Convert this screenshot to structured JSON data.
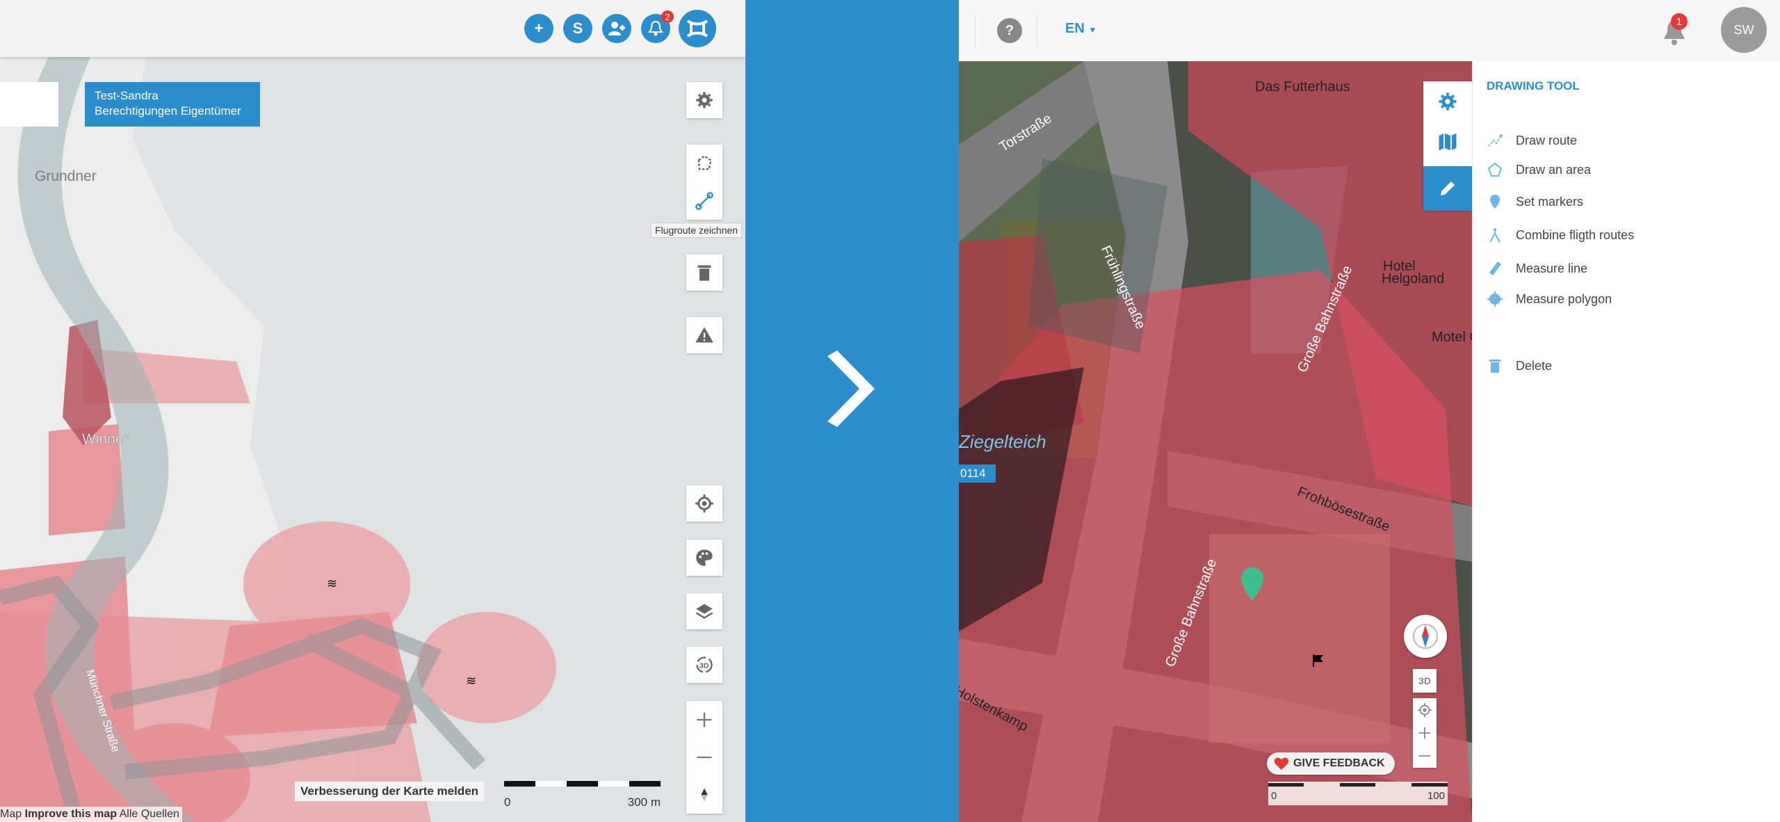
{
  "left": {
    "toolbar": {
      "add_button": "+",
      "s_button": "S",
      "add_user_button": "add-user-icon",
      "notification_count": "2",
      "logo": "drone-logo-icon"
    },
    "tooltip": {
      "line1": "Test-Sandra",
      "line2": "Berechtigungen Eigentümer"
    },
    "map_labels": {
      "grundner": "Grundner",
      "winner": "Winner",
      "street": "Münchner Straße"
    },
    "route_tooltip": "Flugroute zeichnen",
    "report_button": "Verbesserung der Karte melden",
    "scale": {
      "start": "0",
      "end": "300 m"
    },
    "attribution": {
      "map": "Map",
      "improve": "Improve this map",
      "sources": "Alle Quellen"
    }
  },
  "right": {
    "topbar": {
      "help": "?",
      "language": "EN",
      "notification_count": "1",
      "avatar": "SW"
    },
    "map_labels": {
      "torstrasse": "Torstraße",
      "futterhaus": "Das Futterhaus",
      "fruehling": "Frühlingstraße",
      "bahnstrasse_top": "Große Bahnstraße",
      "hotel": "Hotel",
      "helgoland": "Helgoland",
      "motel": "Motel O",
      "ziegelteich": "Ziegelteich",
      "frohboese": "Frohbösestraße",
      "bahnstrasse_bottom": "Große Bahnstraße",
      "holstenkamp": "Holstenkamp",
      "tag": "0114"
    },
    "drawing_tool": {
      "title": "DRAWING TOOL",
      "items": [
        {
          "label": "Draw route",
          "icon": "route-icon"
        },
        {
          "label": "Draw an area",
          "icon": "polygon-icon"
        },
        {
          "label": "Set markers",
          "icon": "marker-icon"
        },
        {
          "label": "Combine fligth routes",
          "icon": "combine-icon"
        },
        {
          "label": "Measure line",
          "icon": "ruler-icon"
        },
        {
          "label": "Measure polygon",
          "icon": "measure-polygon-icon"
        }
      ],
      "delete": "Delete"
    },
    "map_controls": {
      "three_d": "3D",
      "feedback": "GIVE FEEDBACK"
    },
    "scale": {
      "start": "0",
      "end": "100"
    }
  },
  "colors": {
    "accent": "#2b8dcb",
    "zone_red": "#e0505e",
    "badge": "#e53935",
    "marker_green": "#3fbf8f"
  }
}
